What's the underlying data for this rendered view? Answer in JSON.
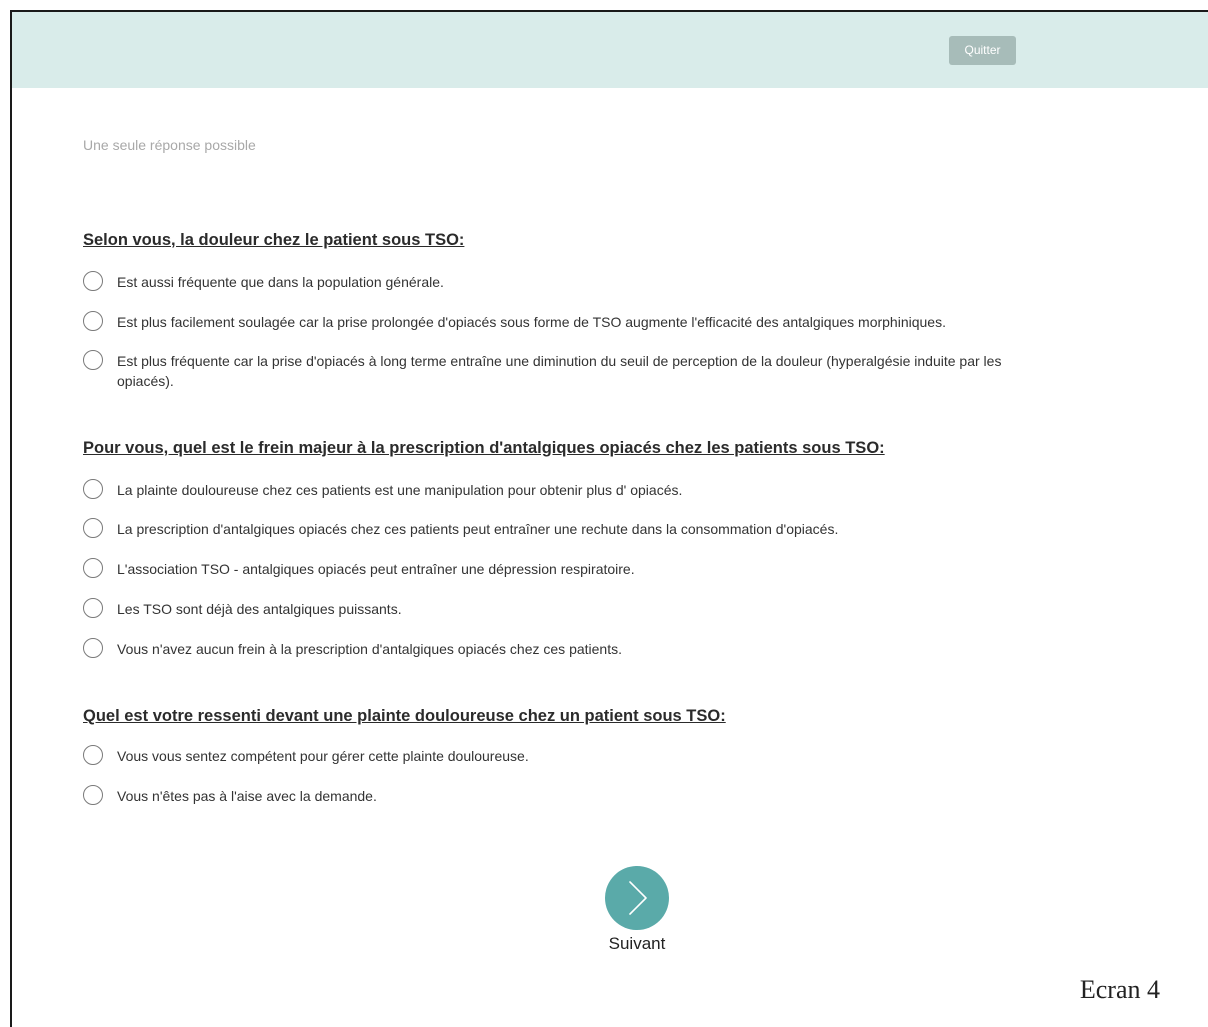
{
  "header": {
    "quit_label": "Quitter"
  },
  "hint": "Une seule réponse possible",
  "questions": [
    {
      "title": "Selon vous, la douleur chez le patient sous TSO:",
      "options": [
        "Est aussi fréquente que dans la population générale.",
        "Est plus facilement soulagée car la prise prolongée d'opiacés sous forme de TSO augmente l'efficacité des antalgiques morphiniques.",
        "Est plus fréquente car la prise d'opiacés à long terme entraîne une diminution du seuil de perception de la douleur (hyperalgésie induite par les opiacés)."
      ]
    },
    {
      "title": "Pour vous, quel est le frein majeur à la prescription d'antalgiques opiacés chez les patients sous TSO:",
      "options": [
        "La plainte douloureuse chez ces patients est une manipulation pour obtenir plus d' opiacés.",
        "La prescription d'antalgiques opiacés chez ces patients peut entraîner une rechute dans la consommation d'opiacés.",
        "L'association TSO - antalgiques opiacés peut entraîner une dépression respiratoire.",
        "Les TSO sont déjà des antalgiques puissants.",
        "Vous n'avez aucun frein à la prescription d'antalgiques opiacés chez ces patients."
      ]
    },
    {
      "title": "Quel est votre ressenti devant une plainte douloureuse chez un patient sous TSO:",
      "options": [
        "Vous vous sentez compétent pour gérer cette plainte douloureuse.",
        "Vous n'êtes pas à l'aise avec la demande."
      ]
    }
  ],
  "navigation": {
    "next_label": "Suivant",
    "next_icon": "chevron-right-icon"
  },
  "screen_label": "Ecran 4",
  "colors": {
    "header_background": "#d9ecea",
    "quit_button": "#a7bcb9",
    "next_button": "#5aaaa9"
  }
}
